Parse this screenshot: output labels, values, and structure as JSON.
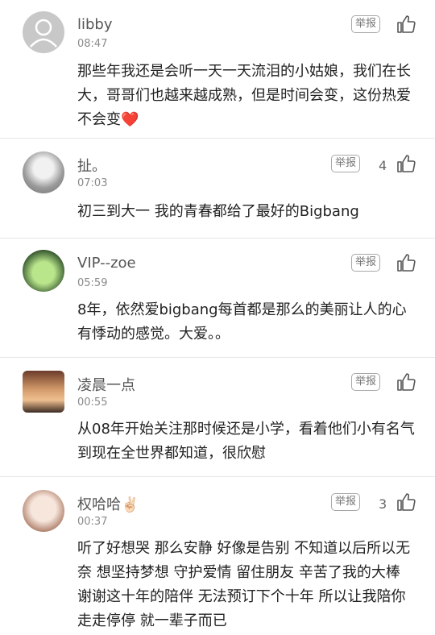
{
  "comments": [
    {
      "user": "libby",
      "time": "08:47",
      "report_label": "举报",
      "likes": "",
      "text": "那些年我还是会听一天一天流泪的小姑娘，我们在长大，哥哥们也越来越成熟，但是时间会变，这份热爱不会变❤️",
      "avatar": "default-avatar"
    },
    {
      "user": "扯。",
      "time": "07:03",
      "report_label": "举报",
      "likes": "4",
      "text": "初三到大一 我的青春都给了最好的Bigbang",
      "avatar": "photo-avatar"
    },
    {
      "user": "VIP--zoe",
      "time": "05:59",
      "report_label": "举报",
      "likes": "",
      "text": "8年，依然爱bigbang每首都是那么的美丽让人的心有悸动的感觉。大爱。。",
      "avatar": "photo-avatar"
    },
    {
      "user": "凌晨一点",
      "time": "00:55",
      "report_label": "举报",
      "likes": "",
      "text": "从08年开始关注那时候还是小学，看着他们小有名气到现在全世界都知道，很欣慰",
      "avatar": "photo-avatar"
    },
    {
      "user": "权哈哈✌🏻",
      "time": "00:37",
      "report_label": "举报",
      "likes": "3",
      "text": "听了好想哭 那么安静 好像是告别 不知道以后所以无奈 想坚持梦想 守护爱情 留住朋友 辛苦了我的大棒 谢谢这十年的陪伴 无法预订下个十年 所以让我陪你走走停停 就一辈子而已",
      "avatar": "photo-avatar"
    }
  ],
  "colors": {
    "text": "#222222",
    "meta": "#8a8a8a",
    "divider": "#e6e6e6"
  },
  "icons": [
    "thumb-up-icon",
    "default-avatar-icon"
  ]
}
